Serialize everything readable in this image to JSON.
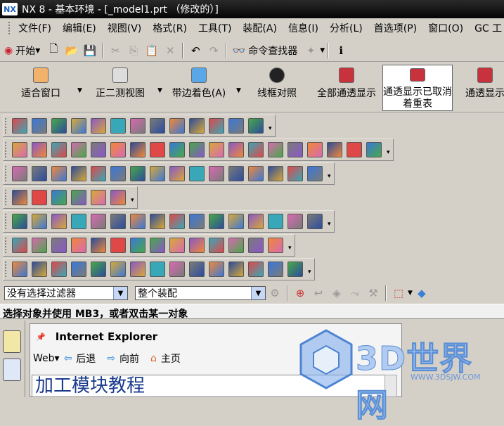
{
  "window": {
    "title": "NX 8 - 基本环境 - [_model1.prt （修改的）]",
    "logo": "NX"
  },
  "menu": [
    "文件(F)",
    "编辑(E)",
    "视图(V)",
    "格式(R)",
    "工具(T)",
    "装配(A)",
    "信息(I)",
    "分析(L)",
    "首选项(P)",
    "窗口(O)",
    "GC 工"
  ],
  "standard": {
    "start_label": "开始",
    "command_finder": "命令查找器"
  },
  "view_toolbar": {
    "fit": "适合窗口",
    "trimetric": "正二测视图",
    "shaded": "带边着色(A)",
    "wireframe": "线框对照",
    "all_translucent": "全部通透显示",
    "translucent_cancel": "通透显示已取消着重表",
    "translucent_show": "通透显示"
  },
  "filter": {
    "selection_filter": "没有选择过滤器",
    "assembly_scope": "整个装配"
  },
  "status": {
    "prompt": "选择对象并使用 MB3，或者双击某一对象"
  },
  "browser": {
    "title": "Internet Explorer",
    "web_label": "Web",
    "back": "后退",
    "forward": "向前",
    "home": "主页",
    "page_heading": "加工模块教程"
  },
  "watermark": {
    "brand": "3D世界网",
    "url": "WWW.3DSJW.COM"
  },
  "icon_rows": [
    13,
    19,
    16,
    6,
    16,
    14,
    15
  ],
  "colors": {
    "titlebar": "#050505",
    "toolbar": "#d4d0c8",
    "combo_button": "#c7d8f5",
    "heading": "#1a3b8c"
  }
}
